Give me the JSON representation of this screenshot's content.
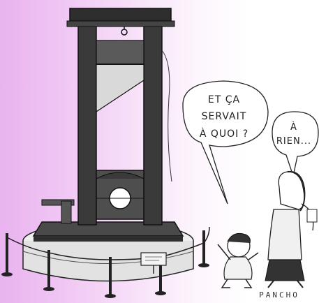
{
  "cartoon": {
    "bubble_child": [
      "ET ÇA",
      "SERVAIT",
      "À QUOI ?"
    ],
    "bubble_adult": [
      "À",
      "RIEN..."
    ],
    "signature": "PANCHO"
  },
  "colors": {
    "background_tint": "#e9b3ef",
    "ink": "#222222",
    "wood": "#3a3a3a"
  }
}
